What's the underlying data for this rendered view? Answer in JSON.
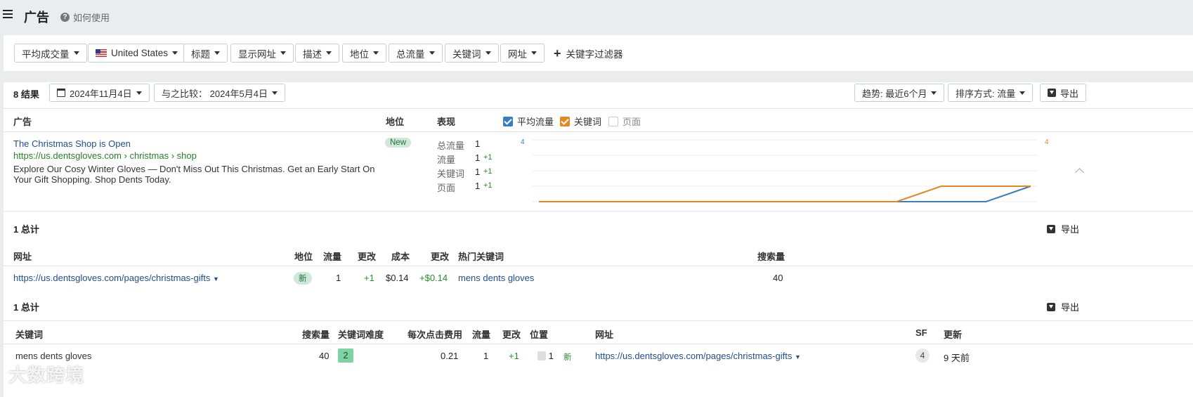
{
  "header": {
    "title": "广告",
    "help_label": "如何使用"
  },
  "filters": [
    {
      "label": "平均成交量"
    },
    {
      "label": "United States",
      "flag": "us"
    },
    {
      "label": "标题"
    },
    {
      "label": "显示网址"
    },
    {
      "label": "描述"
    },
    {
      "label": "地位"
    },
    {
      "label": "总流量"
    },
    {
      "label": "关键词"
    },
    {
      "label": "网址"
    }
  ],
  "keyword_filter_label": "关键字过滤器",
  "results_bar": {
    "count": "8 结果",
    "date": "2024年11月4日",
    "compare": "与之比较：  2024年5月4日",
    "trend": "趋势: 最近6个月",
    "sort": "排序方式: 流量",
    "export": "导出"
  },
  "ads_table": {
    "headers": {
      "ad": "广告",
      "position": "地位",
      "performance": "表现"
    },
    "checkboxes": [
      {
        "label": "平均流量",
        "checked": true,
        "color": "#3a7ebf"
      },
      {
        "label": "关键词",
        "checked": true,
        "color": "#e5891f"
      },
      {
        "label": "页面",
        "checked": false,
        "color": "#cccccc"
      }
    ],
    "ad": {
      "title": "The Christmas Shop is Open",
      "url": "https://us.dentsgloves.com › christmas › shop",
      "description": "Explore Our Cosy Winter Gloves — Don't Miss Out This Christmas. Get an Early Start On Your Gift Shopping. Shop Dents Today.",
      "badge": "New",
      "metrics": [
        {
          "label": "总流量",
          "value": "1",
          "delta": ""
        },
        {
          "label": "流量",
          "value": "1",
          "delta": "+1"
        },
        {
          "label": "关键词",
          "value": "1",
          "delta": "+1"
        },
        {
          "label": "页面",
          "value": "1",
          "delta": "+1"
        }
      ]
    }
  },
  "chart_data": {
    "type": "line",
    "title": "",
    "y_left_max_label": "4",
    "y_right_max_label": "4",
    "ylim": [
      0,
      4
    ],
    "series": [
      {
        "name": "平均流量",
        "color": "#3a7ebf",
        "values": [
          0,
          0,
          0,
          0,
          0,
          0,
          0,
          0,
          0,
          0,
          0,
          1
        ]
      },
      {
        "name": "关键词",
        "color": "#e5891f",
        "values": [
          0,
          0,
          0,
          0,
          0,
          0,
          0,
          0,
          0,
          1,
          1,
          1
        ]
      }
    ]
  },
  "urls_section": {
    "total": "1 总计",
    "export": "导出",
    "headers": [
      "网址",
      "地位",
      "流量",
      "更改",
      "成本",
      "更改",
      "热门关键词",
      "搜索量"
    ],
    "row": {
      "url": "https://us.dentsgloves.com/pages/christmas-gifts",
      "badge": "新",
      "traffic": "1",
      "change": "+1",
      "cost": "$0.14",
      "cost_change": "+$0.14",
      "top_keyword": "mens dents gloves",
      "volume": "40"
    }
  },
  "keywords_section": {
    "total": "1 总计",
    "export": "导出",
    "headers": [
      "关键词",
      "搜索量",
      "关键词难度",
      "每次点击费用",
      "流量",
      "更改",
      "位置",
      "网址",
      "SF",
      "更新"
    ],
    "row": {
      "keyword": "mens dents gloves",
      "volume": "40",
      "kd": "2",
      "cpc": "0.21",
      "traffic": "1",
      "change": "+1",
      "position": "1",
      "position_badge": "新",
      "url": "https://us.dentsgloves.com/pages/christmas-gifts",
      "sf": "4",
      "updated": "9 天前"
    }
  },
  "watermark": "大数跨境"
}
